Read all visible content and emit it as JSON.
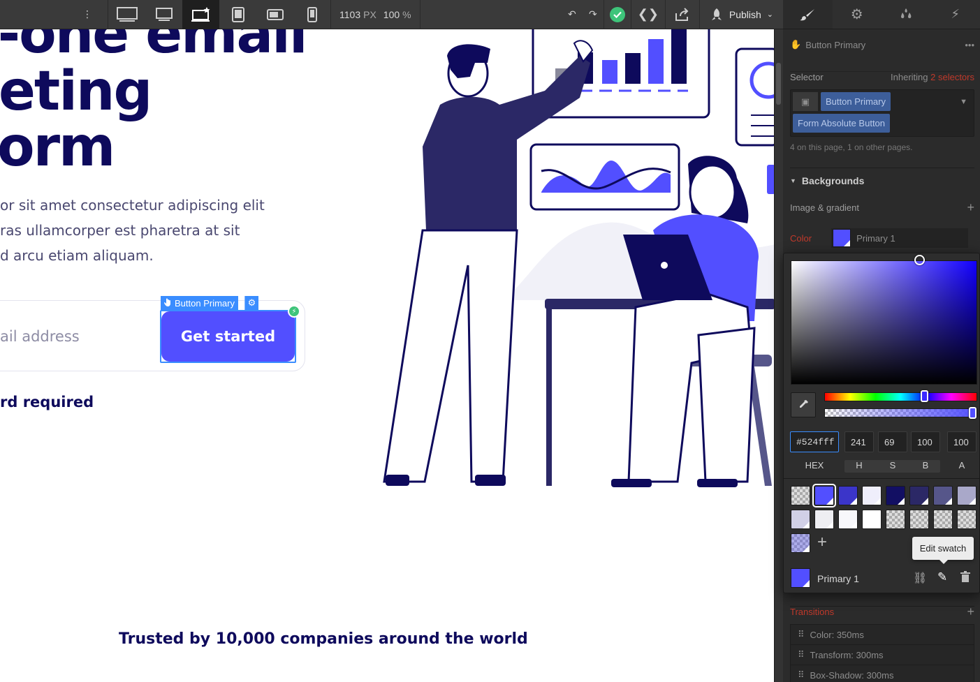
{
  "canvas": {
    "hero_lines": [
      "l-one email",
      "eting",
      "orm"
    ],
    "subtitle_lines": [
      "or sit amet consectetur adipiscing elit",
      "ras ullamcorper est pharetra at sit",
      "d arcu etiam aliquam."
    ],
    "email_placeholder": "ail address",
    "cta_label": "Get started",
    "card_text": "rd required",
    "trusted": "Trusted by 10,000 companies around the world",
    "selection_label": "Button Primary"
  },
  "toolbar": {
    "viewport_width": "1103",
    "viewport_unit": "PX",
    "zoom": "100",
    "zoom_unit": "%",
    "publish_label": "Publish"
  },
  "panel": {
    "element_name": "Button Primary",
    "selector_label": "Selector",
    "inheriting_label": "Inheriting",
    "inheriting_count": "2 selectors",
    "selector_chips": [
      "Button Primary",
      "Form Absolute Button"
    ],
    "usage_text": "4 on this page, 1 on other pages.",
    "backgrounds_title": "Backgrounds",
    "image_gradient_label": "Image & gradient",
    "color_label": "Color",
    "color_value_name": "Primary 1",
    "transitions_title": "Transitions",
    "transitions": [
      "Color: 350ms",
      "Transform: 300ms",
      "Box-Shadow: 300ms"
    ]
  },
  "picker": {
    "hex": "#524fff",
    "h": "241",
    "s": "69",
    "b": "100",
    "a": "100",
    "labels": {
      "hex": "HEX",
      "h": "H",
      "s": "S",
      "b": "B",
      "a": "A"
    },
    "swatch_colors": [
      "checker",
      "#524fff",
      "#3b35c9",
      "#efeefb",
      "#120f63",
      "#2b2866",
      "#56568a",
      "#a9a8c9",
      "#d1d0e6",
      "#eeeef2",
      "#f8f8fb",
      "#ffffff",
      "checker",
      "checker",
      "checker",
      "checker",
      "checker-blue"
    ],
    "selected_swatch_name": "Primary 1",
    "tooltip": "Edit swatch"
  },
  "colors": {
    "primary": "#524fff",
    "navy": "#0e0a5c",
    "selection_blue": "#3a8dff",
    "success_green": "#3ec47a",
    "panel_bg": "#2b2b2b"
  }
}
